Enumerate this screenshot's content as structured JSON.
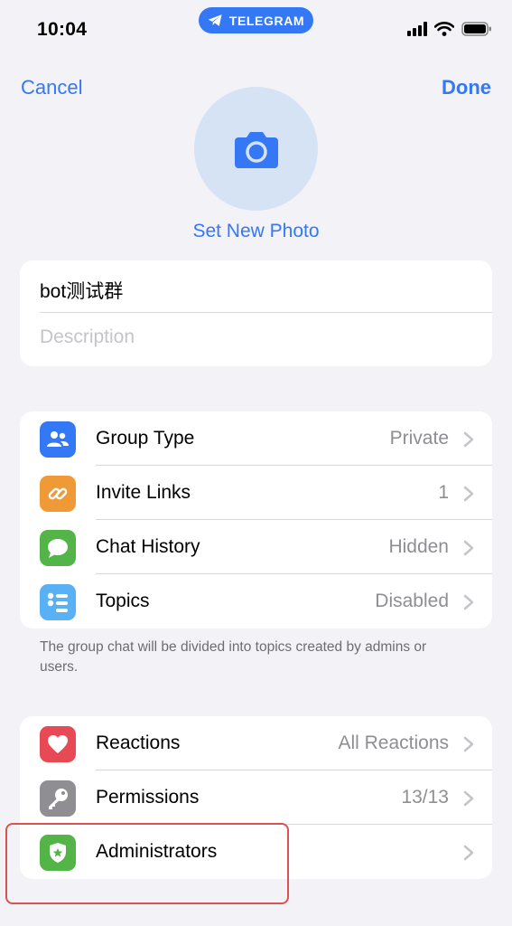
{
  "status_bar": {
    "time": "10:04",
    "app_pill": "TELEGRAM"
  },
  "nav": {
    "cancel_label": "Cancel",
    "done_label": "Done"
  },
  "photo": {
    "set_photo_label": "Set New Photo",
    "icon": "camera-icon"
  },
  "group": {
    "name": "bot测试群",
    "description_placeholder": "Description"
  },
  "settings_section": {
    "rows": [
      {
        "label": "Group Type",
        "value": "Private",
        "icon": "group-icon",
        "color": "#3478f6"
      },
      {
        "label": "Invite Links",
        "value": "1",
        "icon": "link-icon",
        "color": "#f09a37"
      },
      {
        "label": "Chat History",
        "value": "Hidden",
        "icon": "chat-bubble-icon",
        "color": "#53b548"
      },
      {
        "label": "Topics",
        "value": "Disabled",
        "icon": "topics-list-icon",
        "color": "#5ab0f5"
      }
    ],
    "footer": "The group chat will be divided into topics created by admins or users."
  },
  "admin_section": {
    "rows": [
      {
        "label": "Reactions",
        "value": "All Reactions",
        "icon": "heart-icon",
        "color": "#e84a55"
      },
      {
        "label": "Permissions",
        "value": "13/13",
        "icon": "key-icon",
        "color": "#8e8e93"
      },
      {
        "label": "Administrators",
        "value": "",
        "icon": "shield-star-icon",
        "color": "#53b548"
      }
    ]
  },
  "colors": {
    "accent": "#3478f6",
    "background": "#f2f2f7",
    "highlight": "#d9534f"
  }
}
